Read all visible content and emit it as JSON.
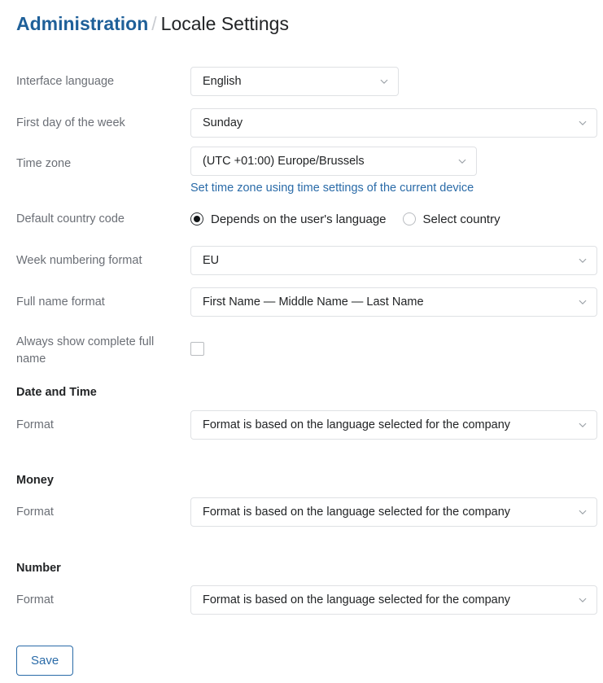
{
  "breadcrumb": {
    "parent": "Administration",
    "separator": "/",
    "current": "Locale Settings"
  },
  "fields": {
    "interface_language": {
      "label": "Interface language",
      "value": "English"
    },
    "first_day_of_week": {
      "label": "First day of the week",
      "value": "Sunday"
    },
    "time_zone": {
      "label": "Time zone",
      "value": "(UTC +01:00) Europe/Brussels",
      "helper_link": "Set time zone using time settings of the current device"
    },
    "default_country_code": {
      "label": "Default country code",
      "options": [
        {
          "text": "Depends on the user's language",
          "selected": true
        },
        {
          "text": "Select country",
          "selected": false
        }
      ]
    },
    "week_numbering_format": {
      "label": "Week numbering format",
      "value": "EU"
    },
    "full_name_format": {
      "label": "Full name format",
      "value": "First Name — Middle Name — Last Name"
    },
    "always_show_complete_full_name": {
      "label": "Always show complete full name",
      "checked": false
    }
  },
  "sections": [
    {
      "title": "Date and Time",
      "format_label": "Format",
      "format_value": "Format is based on the language selected for the company"
    },
    {
      "title": "Money",
      "format_label": "Format",
      "format_value": "Format is based on the language selected for the company"
    },
    {
      "title": "Number",
      "format_label": "Format",
      "format_value": "Format is based on the language selected for the company"
    }
  ],
  "actions": {
    "save_label": "Save"
  },
  "icons": {
    "chevron": "chevron-down-icon"
  },
  "colors": {
    "link": "#2a6ba8",
    "crumb": "#1f6099",
    "label": "#6b6f76",
    "value": "#222426",
    "border": "#dfe1e4"
  }
}
